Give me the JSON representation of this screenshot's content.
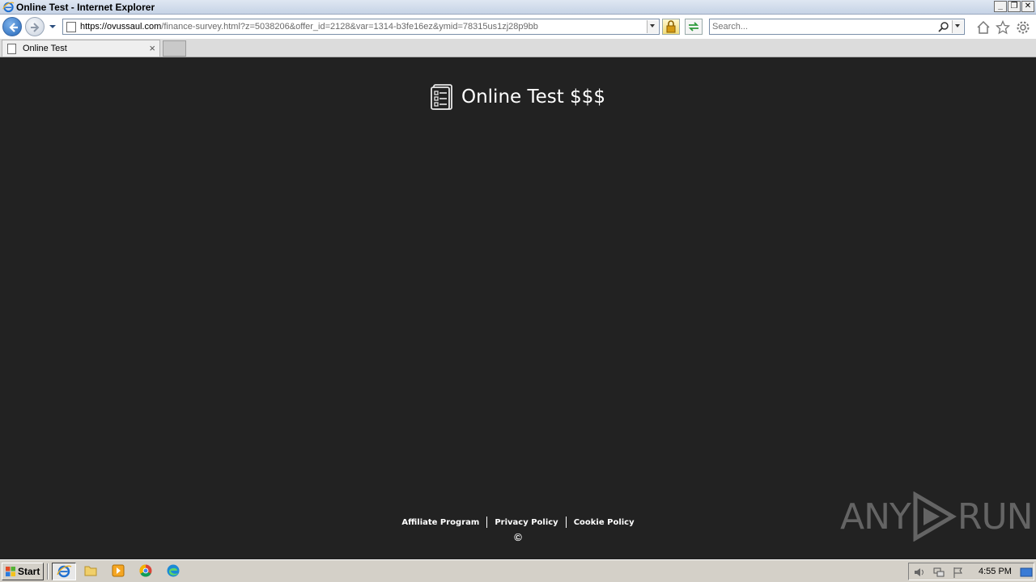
{
  "window": {
    "title": "Online Test - Internet Explorer",
    "controls": {
      "minimize": "_",
      "restore": "❐",
      "close": "✕"
    }
  },
  "navbar": {
    "url_host": "https://ovussaul.com",
    "url_path": "/finance-survey.html?z=5038206&offer_id=2128&var=1314-b3fe16ez&ymid=78315us1zj28p9bb",
    "search_placeholder": "Search..."
  },
  "tabs": [
    {
      "label": "Online Test",
      "close": "×"
    }
  ],
  "page": {
    "site_title": "Online Test $$$",
    "footer_links": [
      "Affiliate Program",
      "Privacy Policy",
      "Cookie Policy"
    ],
    "copyright": "©",
    "watermark": {
      "left": "ANY",
      "right": "RUN"
    }
  },
  "taskbar": {
    "start_label": "Start",
    "apps": [
      "internet-explorer",
      "file-explorer",
      "media-player",
      "chrome",
      "edge"
    ],
    "clock": "4:55 PM"
  },
  "colors": {
    "page_background": "#222222",
    "ie_accent": "#2467b9",
    "taskbar": "#d4d0c8"
  }
}
